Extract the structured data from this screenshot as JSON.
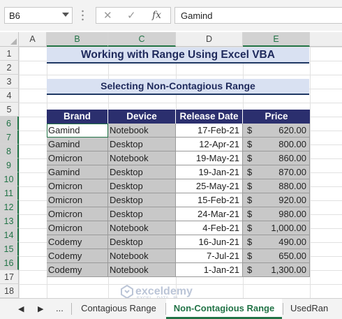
{
  "formula_bar": {
    "name_box": "B6",
    "cancel_symbol": "✕",
    "enter_symbol": "✓",
    "fx_symbol": "fx",
    "formula_value": "Gamind"
  },
  "columns": [
    "A",
    "B",
    "C",
    "D",
    "E"
  ],
  "selected_columns": [
    "B",
    "C",
    "E"
  ],
  "rows": [
    "1",
    "2",
    "3",
    "4",
    "5",
    "6",
    "7",
    "8",
    "9",
    "10",
    "11",
    "12",
    "13",
    "14",
    "15",
    "16",
    "17",
    "18"
  ],
  "title": "Working with Range Using Excel VBA",
  "subtitle": "Selecting Non-Contagious Range",
  "table": {
    "headers": [
      "Brand",
      "Device",
      "Release Date",
      "Price"
    ],
    "rows": [
      {
        "brand": "Gamind",
        "device": "Notebook",
        "date": "17-Feb-21",
        "cur": "$",
        "price": "620.00"
      },
      {
        "brand": "Gamind",
        "device": "Desktop",
        "date": "12-Apr-21",
        "cur": "$",
        "price": "800.00"
      },
      {
        "brand": "Omicron",
        "device": "Notebook",
        "date": "19-May-21",
        "cur": "$",
        "price": "860.00"
      },
      {
        "brand": "Gamind",
        "device": "Desktop",
        "date": "19-Jan-21",
        "cur": "$",
        "price": "870.00"
      },
      {
        "brand": "Omicron",
        "device": "Desktop",
        "date": "25-May-21",
        "cur": "$",
        "price": "880.00"
      },
      {
        "brand": "Omicron",
        "device": "Desktop",
        "date": "15-Feb-21",
        "cur": "$",
        "price": "920.00"
      },
      {
        "brand": "Omicron",
        "device": "Desktop",
        "date": "24-Mar-21",
        "cur": "$",
        "price": "980.00"
      },
      {
        "brand": "Omicron",
        "device": "Notebook",
        "date": "4-Feb-21",
        "cur": "$",
        "price": "1,000.00"
      },
      {
        "brand": "Codemy",
        "device": "Desktop",
        "date": "16-Jun-21",
        "cur": "$",
        "price": "490.00"
      },
      {
        "brand": "Codemy",
        "device": "Notebook",
        "date": "7-Jul-21",
        "cur": "$",
        "price": "650.00"
      },
      {
        "brand": "Codemy",
        "device": "Notebook",
        "date": "1-Jan-21",
        "cur": "$",
        "price": "1,300.00"
      }
    ]
  },
  "sheet_tabs": {
    "nav_prev": "◀",
    "nav_next": "▶",
    "ellipsis": "...",
    "tabs": [
      "Contagious Range",
      "Non-Contagious Range",
      "UsedRan"
    ],
    "active": "Non-Contagious Range"
  },
  "watermark": {
    "name": "exceldemy",
    "tagline": "EXCEL · DATA · BI"
  },
  "colors": {
    "accent": "#217346",
    "header_fill": "#2b2f6e",
    "title_fill": "#d9e1f2",
    "selection_gray": "#c8c8c8"
  }
}
